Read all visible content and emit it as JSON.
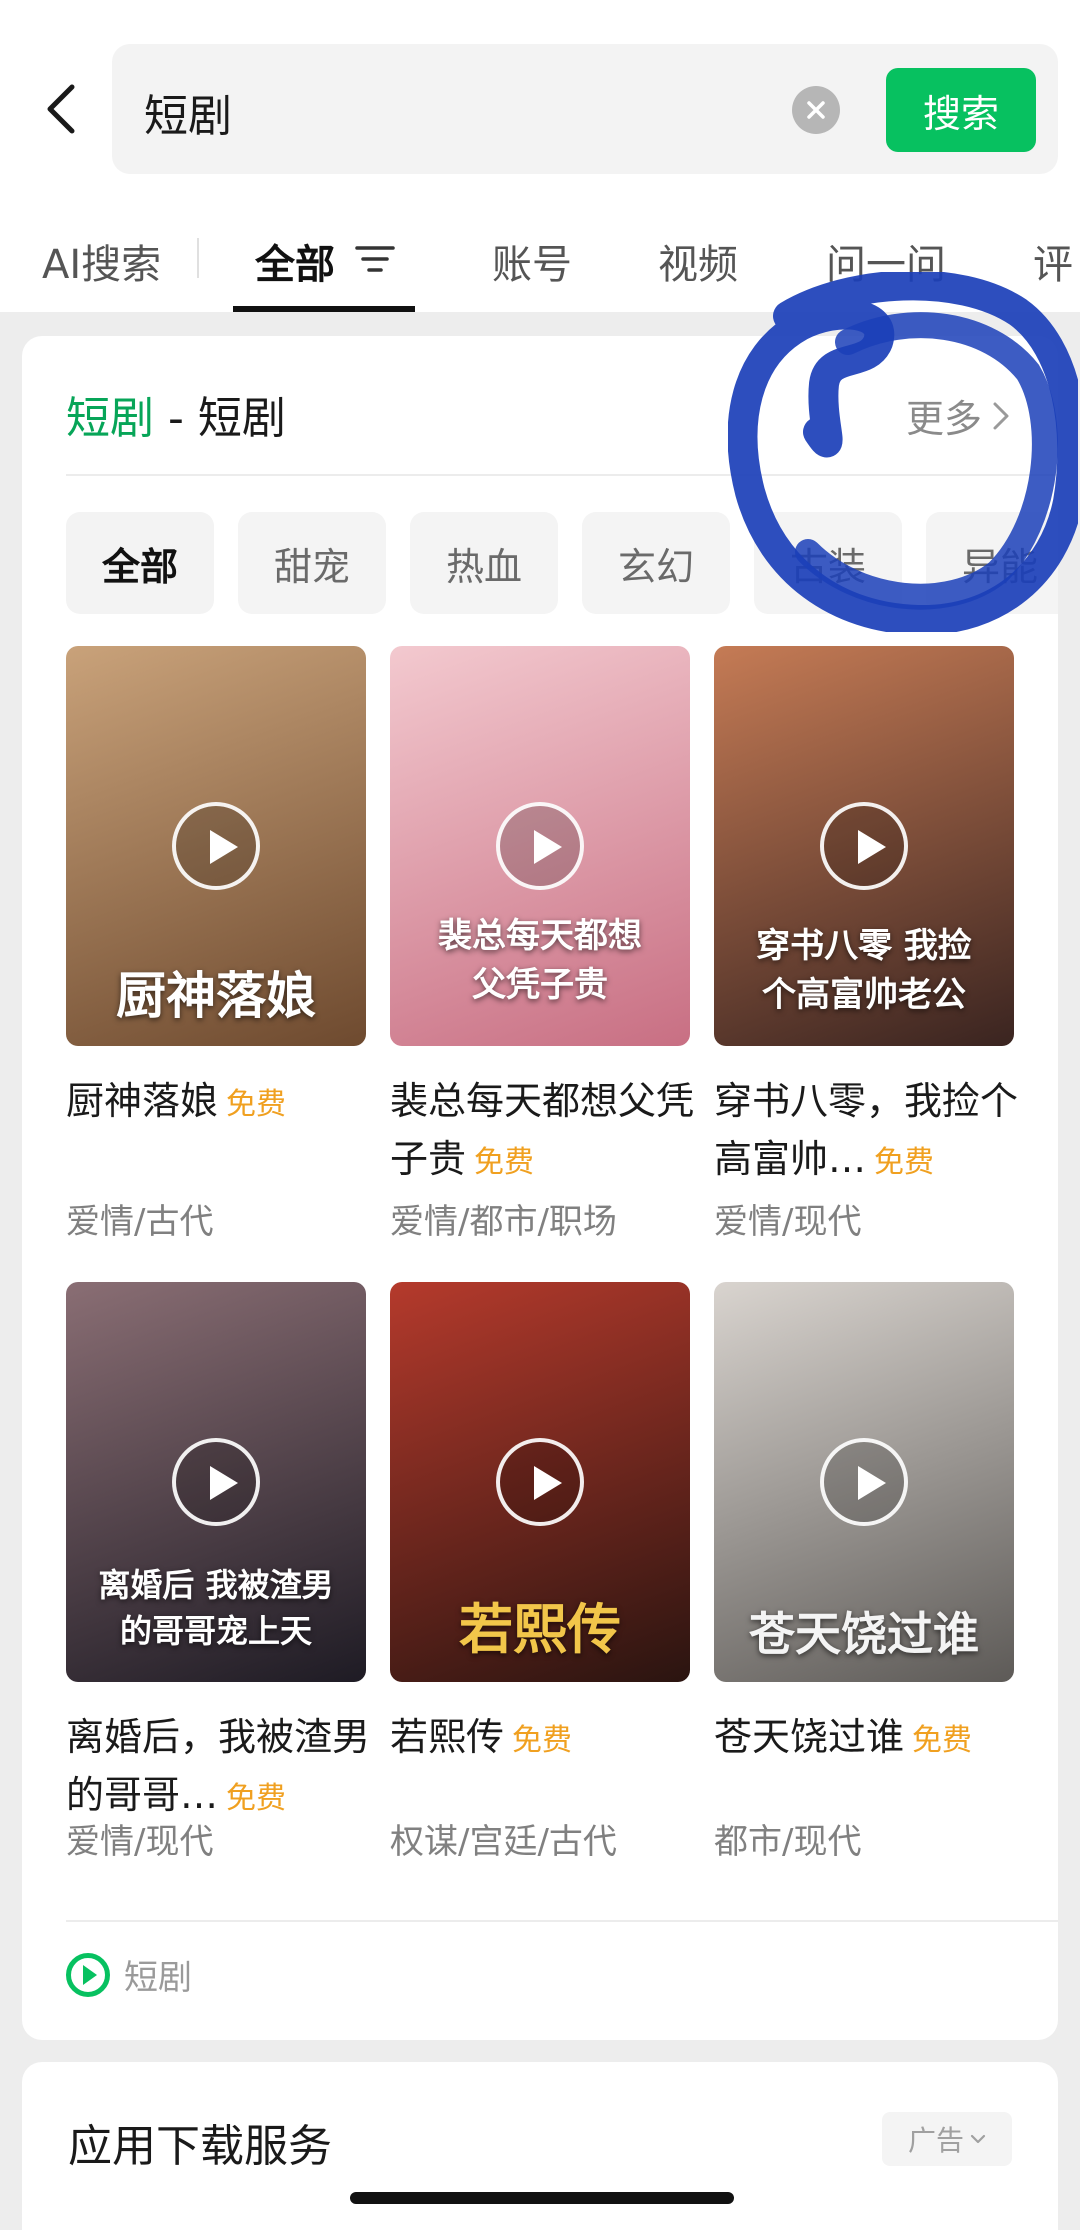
{
  "search": {
    "query": "短剧",
    "button_label": "搜索"
  },
  "tabs": [
    {
      "label": "AI搜索"
    },
    {
      "label": "全部"
    },
    {
      "label": "账号"
    },
    {
      "label": "视频"
    },
    {
      "label": "问一问"
    },
    {
      "label": "评"
    }
  ],
  "card": {
    "title_highlight": "短剧",
    "title_rest": " - 短剧",
    "more_label": "更多",
    "chips": [
      "全部",
      "甜宠",
      "热血",
      "玄幻",
      "古装",
      "异能"
    ],
    "free_label": "免费",
    "dramas": [
      {
        "title": "厨神落娘",
        "poster_text": "厨神落娘",
        "genre": "爱情/古代",
        "free": true,
        "colors": [
          "#c9a27a",
          "#6e4a2f"
        ]
      },
      {
        "title": "裴总每天都想父凭子贵",
        "title_display": "裴总每天都想父凭子贵",
        "poster_text": "裴总每天都想父凭子贵",
        "genre": "爱情/都市/职场",
        "free": true,
        "colors": [
          "#f3c9cf",
          "#c86f83"
        ]
      },
      {
        "title": "穿书八零，我捡个高富帅…",
        "poster_text": "穿书八零 我捡个高富帅老公",
        "genre": "爱情/现代",
        "free": true,
        "colors": [
          "#c57b55",
          "#3a2420"
        ]
      },
      {
        "title": "离婚后，我被渣男的哥哥…",
        "poster_text": "离婚后 我被渣男的哥哥宠上天",
        "genre": "爱情/现代",
        "free": true,
        "colors": [
          "#8a6e74",
          "#1e1b24"
        ]
      },
      {
        "title": "若熙传",
        "poster_text": "若熙传",
        "genre": "权谋/宫廷/古代",
        "free": true,
        "colors": [
          "#b53a2c",
          "#2a1410"
        ]
      },
      {
        "title": "苍天饶过谁",
        "poster_text": "苍天饶过谁",
        "genre": "都市/现代",
        "free": true,
        "colors": [
          "#d9d4cf",
          "#5d5a57"
        ]
      }
    ],
    "source_label": "短剧"
  },
  "ad_card": {
    "title": "应用下载服务",
    "badge": "广告"
  },
  "colors": {
    "accent_green": "#07c160",
    "free_orange": "#f0a020",
    "annotation_blue": "#1b3fb8"
  }
}
